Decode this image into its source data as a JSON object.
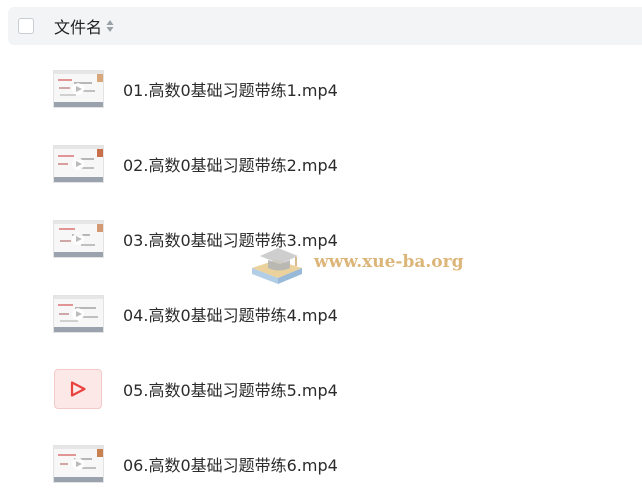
{
  "header": {
    "column_title": "文件名"
  },
  "files": [
    {
      "name": "01.高数0基础习题带练1.mp4",
      "thumb": "video-thumbnail"
    },
    {
      "name": "02.高数0基础习题带练2.mp4",
      "thumb": "video-thumbnail"
    },
    {
      "name": "03.高数0基础习题带练3.mp4",
      "thumb": "video-thumbnail"
    },
    {
      "name": "04.高数0基础习题带练4.mp4",
      "thumb": "video-thumbnail"
    },
    {
      "name": "05.高数0基础习题带练5.mp4",
      "thumb": "video-file-icon"
    },
    {
      "name": "06.高数0基础习题带练6.mp4",
      "thumb": "video-thumbnail"
    }
  ],
  "watermark": {
    "text": "www.xue-ba.org"
  },
  "colors": {
    "header_bg": "#f3f4f6",
    "video_icon_red": "#e8423f",
    "watermark": "#d6a860"
  }
}
